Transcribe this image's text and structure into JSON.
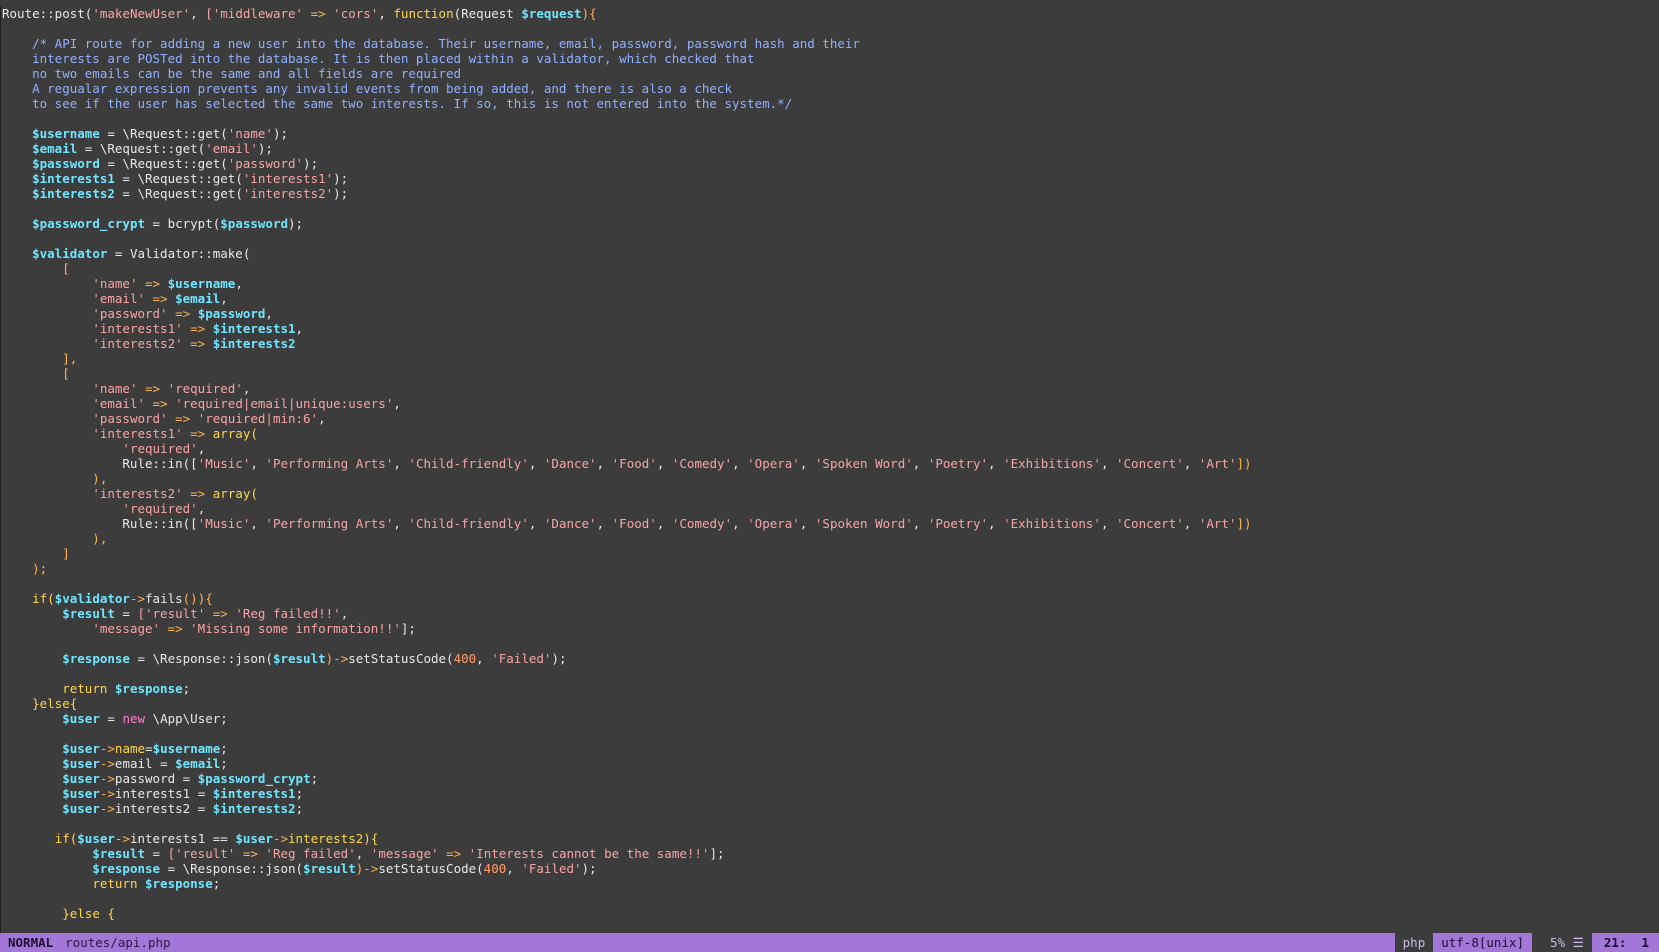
{
  "editor": {
    "lines": [
      [
        [
          "Route::post(",
          "class"
        ],
        [
          "'makeNewUser'",
          "string"
        ],
        [
          ", ",
          "default"
        ],
        [
          "['middleware'",
          "string"
        ],
        [
          " => ",
          "op"
        ],
        [
          "'cors'",
          "string"
        ],
        [
          ", ",
          "default"
        ],
        [
          "function",
          "func"
        ],
        [
          "(Request ",
          "default"
        ],
        [
          "$request",
          "var"
        ],
        [
          "){",
          "paren"
        ]
      ],
      [],
      [
        [
          "    /* API route for adding a new user into the database. Their username, email, password, password hash and their",
          "comment"
        ]
      ],
      [
        [
          "    interests are POSTed into the database. It is then placed within a validator, which checked that",
          "comment"
        ]
      ],
      [
        [
          "    no two emails can be the same and all fields are required",
          "comment"
        ]
      ],
      [
        [
          "    A regualar expression prevents any invalid events from being added, and there is also a check",
          "comment"
        ]
      ],
      [
        [
          "    to see if the user has selected the same two interests. If so, this is not entered into the system.*/",
          "comment"
        ]
      ],
      [],
      [
        [
          "    ",
          "default"
        ],
        [
          "$username",
          "var"
        ],
        [
          " = \\Request::get(",
          "default"
        ],
        [
          "'name'",
          "string"
        ],
        [
          ");",
          "default"
        ]
      ],
      [
        [
          "    ",
          "default"
        ],
        [
          "$email",
          "var"
        ],
        [
          " = \\Request::get(",
          "default"
        ],
        [
          "'email'",
          "string"
        ],
        [
          ");",
          "default"
        ]
      ],
      [
        [
          "    ",
          "default"
        ],
        [
          "$password",
          "var"
        ],
        [
          " = \\Request::get(",
          "default"
        ],
        [
          "'password'",
          "string"
        ],
        [
          ");",
          "default"
        ]
      ],
      [
        [
          "    ",
          "default"
        ],
        [
          "$interests1",
          "var"
        ],
        [
          " = \\Request::get(",
          "default"
        ],
        [
          "'interests1'",
          "string"
        ],
        [
          ");",
          "default"
        ]
      ],
      [
        [
          "    ",
          "default"
        ],
        [
          "$interests2",
          "var"
        ],
        [
          " = \\Request::get(",
          "default"
        ],
        [
          "'interests2'",
          "string"
        ],
        [
          ");",
          "default"
        ]
      ],
      [],
      [
        [
          "    ",
          "default"
        ],
        [
          "$password_crypt",
          "var"
        ],
        [
          " = bcrypt(",
          "default"
        ],
        [
          "$password",
          "var"
        ],
        [
          ");",
          "default"
        ]
      ],
      [],
      [
        [
          "    ",
          "default"
        ],
        [
          "$validator",
          "var"
        ],
        [
          " = Validator::make(",
          "default"
        ]
      ],
      [
        [
          "        [",
          "op"
        ]
      ],
      [
        [
          "            ",
          "default"
        ],
        [
          "'name'",
          "string"
        ],
        [
          " => ",
          "op"
        ],
        [
          "$username",
          "var"
        ],
        [
          ",",
          "default"
        ]
      ],
      [
        [
          "            ",
          "default"
        ],
        [
          "'email'",
          "string"
        ],
        [
          " => ",
          "op"
        ],
        [
          "$email",
          "var"
        ],
        [
          ",",
          "default"
        ]
      ],
      [
        [
          "            ",
          "default"
        ],
        [
          "'password'",
          "string"
        ],
        [
          " => ",
          "op"
        ],
        [
          "$password",
          "var"
        ],
        [
          ",",
          "default"
        ]
      ],
      [
        [
          "            ",
          "default"
        ],
        [
          "'interests1'",
          "string"
        ],
        [
          " => ",
          "op"
        ],
        [
          "$interests1",
          "var"
        ],
        [
          ",",
          "default"
        ]
      ],
      [
        [
          "            ",
          "default"
        ],
        [
          "'interests2'",
          "string"
        ],
        [
          " => ",
          "op"
        ],
        [
          "$interests2",
          "var"
        ]
      ],
      [
        [
          "        ],",
          "op"
        ]
      ],
      [
        [
          "        [",
          "op"
        ]
      ],
      [
        [
          "            ",
          "default"
        ],
        [
          "'name'",
          "string"
        ],
        [
          " => ",
          "op"
        ],
        [
          "'required'",
          "string"
        ],
        [
          ",",
          "default"
        ]
      ],
      [
        [
          "            ",
          "default"
        ],
        [
          "'email'",
          "string"
        ],
        [
          " => ",
          "op"
        ],
        [
          "'required|email|unique:users'",
          "string"
        ],
        [
          ",",
          "default"
        ]
      ],
      [
        [
          "            ",
          "default"
        ],
        [
          "'password'",
          "string"
        ],
        [
          " => ",
          "op"
        ],
        [
          "'required|min:6'",
          "string"
        ],
        [
          ",",
          "default"
        ]
      ],
      [
        [
          "            ",
          "default"
        ],
        [
          "'interests1'",
          "string"
        ],
        [
          " => ",
          "op"
        ],
        [
          "array(",
          "func"
        ]
      ],
      [
        [
          "                ",
          "default"
        ],
        [
          "'required'",
          "string"
        ],
        [
          ",",
          "default"
        ]
      ],
      [
        [
          "                Rule::in([",
          "default"
        ],
        [
          "'Music'",
          "string"
        ],
        [
          ", ",
          "default"
        ],
        [
          "'Performing Arts'",
          "string"
        ],
        [
          ", ",
          "default"
        ],
        [
          "'Child-friendly'",
          "string"
        ],
        [
          ", ",
          "default"
        ],
        [
          "'Dance'",
          "string"
        ],
        [
          ", ",
          "default"
        ],
        [
          "'Food'",
          "string"
        ],
        [
          ", ",
          "default"
        ],
        [
          "'Comedy'",
          "string"
        ],
        [
          ", ",
          "default"
        ],
        [
          "'Opera'",
          "string"
        ],
        [
          ", ",
          "default"
        ],
        [
          "'Spoken Word'",
          "string"
        ],
        [
          ", ",
          "default"
        ],
        [
          "'Poetry'",
          "string"
        ],
        [
          ", ",
          "default"
        ],
        [
          "'Exhibitions'",
          "string"
        ],
        [
          ", ",
          "default"
        ],
        [
          "'Concert'",
          "string"
        ],
        [
          ", ",
          "default"
        ],
        [
          "'Art'",
          "string"
        ],
        [
          "])",
          "paren"
        ]
      ],
      [
        [
          "            ),",
          "op"
        ]
      ],
      [
        [
          "            ",
          "default"
        ],
        [
          "'interests2'",
          "string"
        ],
        [
          " => ",
          "op"
        ],
        [
          "array(",
          "func"
        ]
      ],
      [
        [
          "                ",
          "default"
        ],
        [
          "'required'",
          "string"
        ],
        [
          ",",
          "default"
        ]
      ],
      [
        [
          "                Rule::in([",
          "default"
        ],
        [
          "'Music'",
          "string"
        ],
        [
          ", ",
          "default"
        ],
        [
          "'Performing Arts'",
          "string"
        ],
        [
          ", ",
          "default"
        ],
        [
          "'Child-friendly'",
          "string"
        ],
        [
          ", ",
          "default"
        ],
        [
          "'Dance'",
          "string"
        ],
        [
          ", ",
          "default"
        ],
        [
          "'Food'",
          "string"
        ],
        [
          ", ",
          "default"
        ],
        [
          "'Comedy'",
          "string"
        ],
        [
          ", ",
          "default"
        ],
        [
          "'Opera'",
          "string"
        ],
        [
          ", ",
          "default"
        ],
        [
          "'Spoken Word'",
          "string"
        ],
        [
          ", ",
          "default"
        ],
        [
          "'Poetry'",
          "string"
        ],
        [
          ", ",
          "default"
        ],
        [
          "'Exhibitions'",
          "string"
        ],
        [
          ", ",
          "default"
        ],
        [
          "'Concert'",
          "string"
        ],
        [
          ", ",
          "default"
        ],
        [
          "'Art'",
          "string"
        ],
        [
          "])",
          "paren"
        ]
      ],
      [
        [
          "            ),",
          "op"
        ]
      ],
      [
        [
          "        ]",
          "op"
        ]
      ],
      [
        [
          "    );",
          "op"
        ]
      ],
      [],
      [
        [
          "    ",
          "default"
        ],
        [
          "if(",
          "keyword"
        ],
        [
          "$validator",
          "var"
        ],
        [
          "->",
          "op"
        ],
        [
          "fails",
          "default"
        ],
        [
          "()){",
          "paren"
        ]
      ],
      [
        [
          "        ",
          "default"
        ],
        [
          "$result",
          "var"
        ],
        [
          " = ",
          "default"
        ],
        [
          "['result'",
          "string"
        ],
        [
          " => ",
          "op"
        ],
        [
          "'Reg failed!!'",
          "string"
        ],
        [
          ",",
          "default"
        ]
      ],
      [
        [
          "            ",
          "default"
        ],
        [
          "'message'",
          "string"
        ],
        [
          " => ",
          "op"
        ],
        [
          "'Missing some information!!'",
          "string"
        ],
        [
          "];",
          "default"
        ]
      ],
      [],
      [
        [
          "        ",
          "default"
        ],
        [
          "$response",
          "var"
        ],
        [
          " = \\Response::json(",
          "default"
        ],
        [
          "$result",
          "var"
        ],
        [
          ")->",
          "op"
        ],
        [
          "setStatusCode(",
          "default"
        ],
        [
          "400",
          "number"
        ],
        [
          ", ",
          "default"
        ],
        [
          "'Failed'",
          "string"
        ],
        [
          ");",
          "default"
        ]
      ],
      [],
      [
        [
          "        ",
          "default"
        ],
        [
          "return ",
          "keyword"
        ],
        [
          "$response",
          "var"
        ],
        [
          ";",
          "default"
        ]
      ],
      [
        [
          "    ",
          "default"
        ],
        [
          "}else{",
          "keyword"
        ]
      ],
      [
        [
          "        ",
          "default"
        ],
        [
          "$user",
          "var"
        ],
        [
          " = ",
          "default"
        ],
        [
          "new",
          "new"
        ],
        [
          " \\App\\User;",
          "default"
        ]
      ],
      [],
      [
        [
          "        ",
          "default"
        ],
        [
          "$user",
          "var"
        ],
        [
          "->",
          "op"
        ],
        [
          "name",
          "keyword"
        ],
        [
          "=",
          "default"
        ],
        [
          "$username",
          "var"
        ],
        [
          ";",
          "default"
        ]
      ],
      [
        [
          "        ",
          "default"
        ],
        [
          "$user",
          "var"
        ],
        [
          "->",
          "op"
        ],
        [
          "email = ",
          "default"
        ],
        [
          "$email",
          "var"
        ],
        [
          ";",
          "default"
        ]
      ],
      [
        [
          "        ",
          "default"
        ],
        [
          "$user",
          "var"
        ],
        [
          "->",
          "op"
        ],
        [
          "password = ",
          "default"
        ],
        [
          "$password_crypt",
          "var"
        ],
        [
          ";",
          "default"
        ]
      ],
      [
        [
          "        ",
          "default"
        ],
        [
          "$user",
          "var"
        ],
        [
          "->",
          "op"
        ],
        [
          "interests1 = ",
          "default"
        ],
        [
          "$interests1",
          "var"
        ],
        [
          ";",
          "default"
        ]
      ],
      [
        [
          "        ",
          "default"
        ],
        [
          "$user",
          "var"
        ],
        [
          "->",
          "op"
        ],
        [
          "interests2 = ",
          "default"
        ],
        [
          "$interests2",
          "var"
        ],
        [
          ";",
          "default"
        ]
      ],
      [],
      [
        [
          "       ",
          "default"
        ],
        [
          "if(",
          "keyword"
        ],
        [
          "$user",
          "var"
        ],
        [
          "->",
          "op"
        ],
        [
          "interests1 == ",
          "default"
        ],
        [
          "$user",
          "var"
        ],
        [
          "->",
          "op"
        ],
        [
          "interests2){",
          "keyword"
        ]
      ],
      [
        [
          "            ",
          "default"
        ],
        [
          "$result",
          "var"
        ],
        [
          " = ",
          "default"
        ],
        [
          "['result'",
          "string"
        ],
        [
          " => ",
          "op"
        ],
        [
          "'Reg failed'",
          "string"
        ],
        [
          ", ",
          "default"
        ],
        [
          "'message'",
          "string"
        ],
        [
          " => ",
          "op"
        ],
        [
          "'Interests cannot be the same!!'",
          "string"
        ],
        [
          "];",
          "default"
        ]
      ],
      [
        [
          "            ",
          "default"
        ],
        [
          "$response",
          "var"
        ],
        [
          " = \\Response::json(",
          "default"
        ],
        [
          "$result",
          "var"
        ],
        [
          ")->",
          "op"
        ],
        [
          "setStatusCode(",
          "default"
        ],
        [
          "400",
          "number"
        ],
        [
          ", ",
          "default"
        ],
        [
          "'Failed'",
          "string"
        ],
        [
          ");",
          "default"
        ]
      ],
      [
        [
          "            ",
          "default"
        ],
        [
          "return ",
          "keyword"
        ],
        [
          "$response",
          "var"
        ],
        [
          ";",
          "default"
        ]
      ],
      [],
      [
        [
          "        ",
          "default"
        ],
        [
          "}else {",
          "keyword"
        ]
      ]
    ]
  },
  "statusbar": {
    "mode": "NORMAL",
    "file": "routes/api.php",
    "filetype": "php",
    "encoding": "utf-8[unix]",
    "percent": "5%",
    "menu_glyph": "☰",
    "position": "21:  1"
  }
}
